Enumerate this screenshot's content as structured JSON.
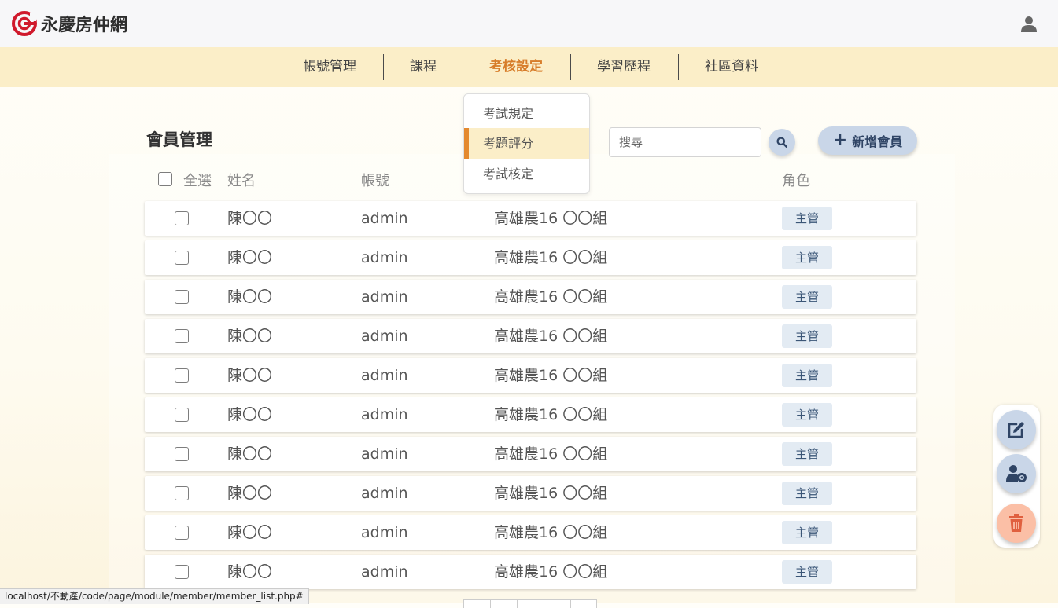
{
  "brand": {
    "name": "永慶房仲網",
    "color": "#d0192c"
  },
  "nav": {
    "items": [
      {
        "label": "帳號管理"
      },
      {
        "label": "課程"
      },
      {
        "label": "考核設定"
      },
      {
        "label": "學習歷程"
      },
      {
        "label": "社區資料"
      }
    ],
    "active_index": 2,
    "accent_color": "#d77d2a"
  },
  "dropdown": {
    "items": [
      {
        "label": "考試規定"
      },
      {
        "label": "考題評分"
      },
      {
        "label": "考試核定"
      }
    ],
    "active_index": 1
  },
  "page": {
    "title": "會員管理",
    "search_placeholder": "搜尋",
    "add_button": "新增會員"
  },
  "table": {
    "select_all": "全選",
    "columns": [
      "姓名",
      "帳號",
      "角色"
    ],
    "rows": [
      {
        "name": "陳〇〇",
        "account": "admin",
        "unit": "高雄農16 〇〇組",
        "role": "主管"
      },
      {
        "name": "陳〇〇",
        "account": "admin",
        "unit": "高雄農16 〇〇組",
        "role": "主管"
      },
      {
        "name": "陳〇〇",
        "account": "admin",
        "unit": "高雄農16 〇〇組",
        "role": "主管"
      },
      {
        "name": "陳〇〇",
        "account": "admin",
        "unit": "高雄農16 〇〇組",
        "role": "主管"
      },
      {
        "name": "陳〇〇",
        "account": "admin",
        "unit": "高雄農16 〇〇組",
        "role": "主管"
      },
      {
        "name": "陳〇〇",
        "account": "admin",
        "unit": "高雄農16 〇〇組",
        "role": "主管"
      },
      {
        "name": "陳〇〇",
        "account": "admin",
        "unit": "高雄農16 〇〇組",
        "role": "主管"
      },
      {
        "name": "陳〇〇",
        "account": "admin",
        "unit": "高雄農16 〇〇組",
        "role": "主管"
      },
      {
        "name": "陳〇〇",
        "account": "admin",
        "unit": "高雄農16 〇〇組",
        "role": "主管"
      },
      {
        "name": "陳〇〇",
        "account": "admin",
        "unit": "高雄農16 〇〇組",
        "role": "主管"
      }
    ]
  },
  "fab": {
    "items": [
      {
        "icon": "edit-icon"
      },
      {
        "icon": "user-settings-icon"
      },
      {
        "icon": "trash-icon"
      }
    ]
  },
  "status_bar": {
    "url": "localhost/不動產/code/page/module/member/member_list.php#"
  }
}
